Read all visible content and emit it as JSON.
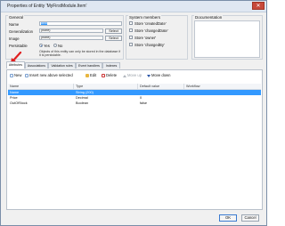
{
  "window": {
    "title": "Properties of Entity 'MyFirstModule.Item'"
  },
  "general": {
    "group_label": "General",
    "name_label": "Name",
    "name_value": "Item",
    "generalization_label": "Generalization",
    "generalization_value": "(none)",
    "image_label": "Image",
    "image_value": "(none)",
    "select_label": "Select",
    "persistable_label": "Persistable",
    "yes_label": "Yes",
    "no_label": "No",
    "persistable_note": "Objects of this entity can only be stored in the database if it is persistable."
  },
  "system_members": {
    "group_label": "System members",
    "items": [
      {
        "label": "Store 'createdDate'"
      },
      {
        "label": "Store 'changedDate'"
      },
      {
        "label": "Store 'owner'"
      },
      {
        "label": "Store 'changedBy'"
      }
    ]
  },
  "documentation": {
    "group_label": "Documentation"
  },
  "tabs": [
    {
      "label": "Attributes"
    },
    {
      "label": "Associations"
    },
    {
      "label": "Validation rules"
    },
    {
      "label": "Event handlers"
    },
    {
      "label": "Indexes"
    }
  ],
  "toolbar": {
    "new": "New",
    "insert": "Insert new above selected",
    "edit": "Edit",
    "delete": "Delete",
    "move_up": "Move up",
    "move_down": "Move down"
  },
  "table": {
    "columns": [
      "Name",
      "Type",
      "Default value",
      "Workflow"
    ],
    "rows": [
      {
        "name": "Name",
        "type": "String (200)",
        "default": ""
      },
      {
        "name": "Price",
        "type": "Decimal",
        "default": "0"
      },
      {
        "name": "OutOfStock",
        "type": "Boolean",
        "default": "false"
      }
    ]
  },
  "footer": {
    "ok": "OK",
    "cancel": "Cancel"
  },
  "colors": {
    "selection": "#3399ff",
    "arrow": "#e02020"
  }
}
